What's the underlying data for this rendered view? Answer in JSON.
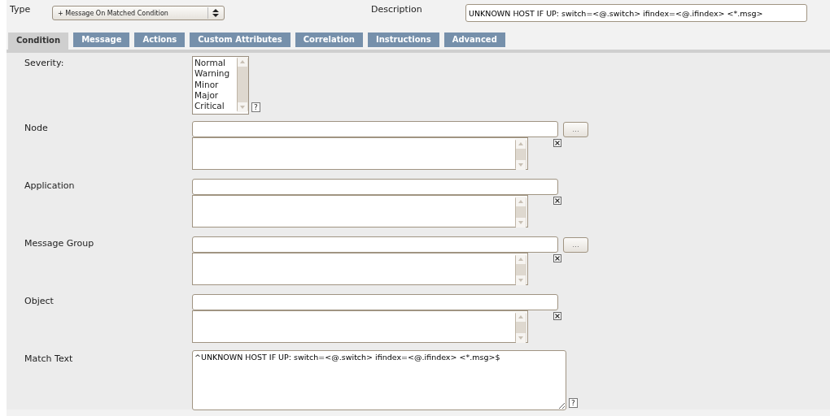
{
  "header": {
    "type_label": "Type",
    "type_value": "+ Message On Matched Condition",
    "description_label": "Description",
    "description_value": "UNKNOWN HOST IF UP: switch=<@.switch> ifindex=<@.ifindex> <*.msg>"
  },
  "tabs": [
    {
      "label": "Condition",
      "selected": true
    },
    {
      "label": "Message",
      "selected": false
    },
    {
      "label": "Actions",
      "selected": false
    },
    {
      "label": "Custom Attributes",
      "selected": false
    },
    {
      "label": "Correlation",
      "selected": false
    },
    {
      "label": "Instructions",
      "selected": false
    },
    {
      "label": "Advanced",
      "selected": false
    }
  ],
  "fields": [
    {
      "kind": "listbox",
      "label": "Severity:",
      "options": [
        "Normal",
        "Warning",
        "Minor",
        "Major",
        "Critical"
      ],
      "help": "?"
    },
    {
      "kind": "picker",
      "label": "Node",
      "browse": "..."
    },
    {
      "kind": "picker",
      "label": "Application"
    },
    {
      "kind": "picker",
      "label": "Message Group",
      "browse": "..."
    },
    {
      "kind": "picker",
      "label": "Object"
    },
    {
      "kind": "textarea",
      "label": "Match Text",
      "value": "^UNKNOWN HOST IF UP: switch=<@.switch> ifindex=<@.ifindex> <*.msg>$",
      "help": "?"
    }
  ]
}
